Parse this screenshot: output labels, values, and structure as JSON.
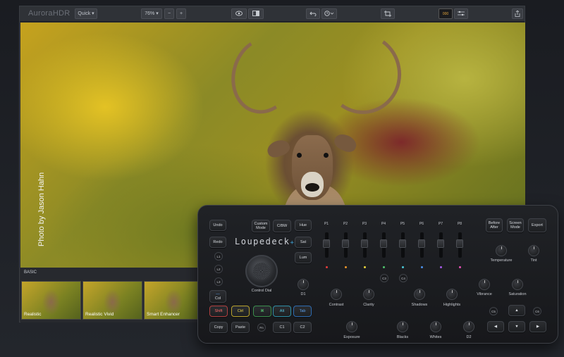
{
  "app": {
    "logo": "AuroraHDR",
    "preset_label": "Quick",
    "zoom_label": "76%",
    "zoom_minus": "−",
    "zoom_plus": "+",
    "layers_label": "000"
  },
  "photo": {
    "credit": "Photo by Jason Hahn"
  },
  "filmstrip": {
    "section_label": "BASIC",
    "thumbs": [
      {
        "label": "Realistic"
      },
      {
        "label": "Realistic Vivid"
      },
      {
        "label": "Smart Enhancer"
      }
    ]
  },
  "console": {
    "brand": "Loupedeck",
    "brand_plus": "+",
    "left_keys": [
      "Undo",
      "Redo"
    ],
    "l_keys": [
      "L1",
      "L2",
      "L3"
    ],
    "mode_keys": [
      "Custom Mode",
      "C/BW"
    ],
    "hsl_keys": [
      "Hue",
      "Sat",
      "Lum"
    ],
    "col_key": "Col",
    "color_keys": [
      "Shift",
      "Ctrl",
      "⌘",
      "Alt",
      "Tab"
    ],
    "bottom_keys": [
      "Copy",
      "Paste",
      "Fn",
      "C1",
      "C2"
    ],
    "top_right_keys": [
      "Before After",
      "Screen Mode",
      "Export"
    ],
    "fader_labels": [
      "P1",
      "P2",
      "P3",
      "P4",
      "P5",
      "P6",
      "P7",
      "P8"
    ],
    "fader_colors": [
      "#e23c3c",
      "#e9952a",
      "#e7d33a",
      "#4ec46b",
      "#4ac7d6",
      "#4a8fe8",
      "#a45be8",
      "#e64fb4"
    ],
    "dial_label": "Control Dial",
    "round_labels": [
      "C3",
      "C4",
      "C5",
      "C6"
    ],
    "knobs": {
      "d1": "D1",
      "contrast": "Contrast",
      "clarity": "Clarity",
      "shadows": "Shadows",
      "highlights": "Highlights",
      "vibrance": "Vibrance",
      "saturation": "Saturation",
      "temperature": "Temperature",
      "tint": "Tint",
      "exposure": "Exposure",
      "blacks": "Blacks",
      "whites": "Whites",
      "d2": "D2"
    },
    "arrows": [
      "▲",
      "◀",
      "▼",
      "▶"
    ]
  }
}
